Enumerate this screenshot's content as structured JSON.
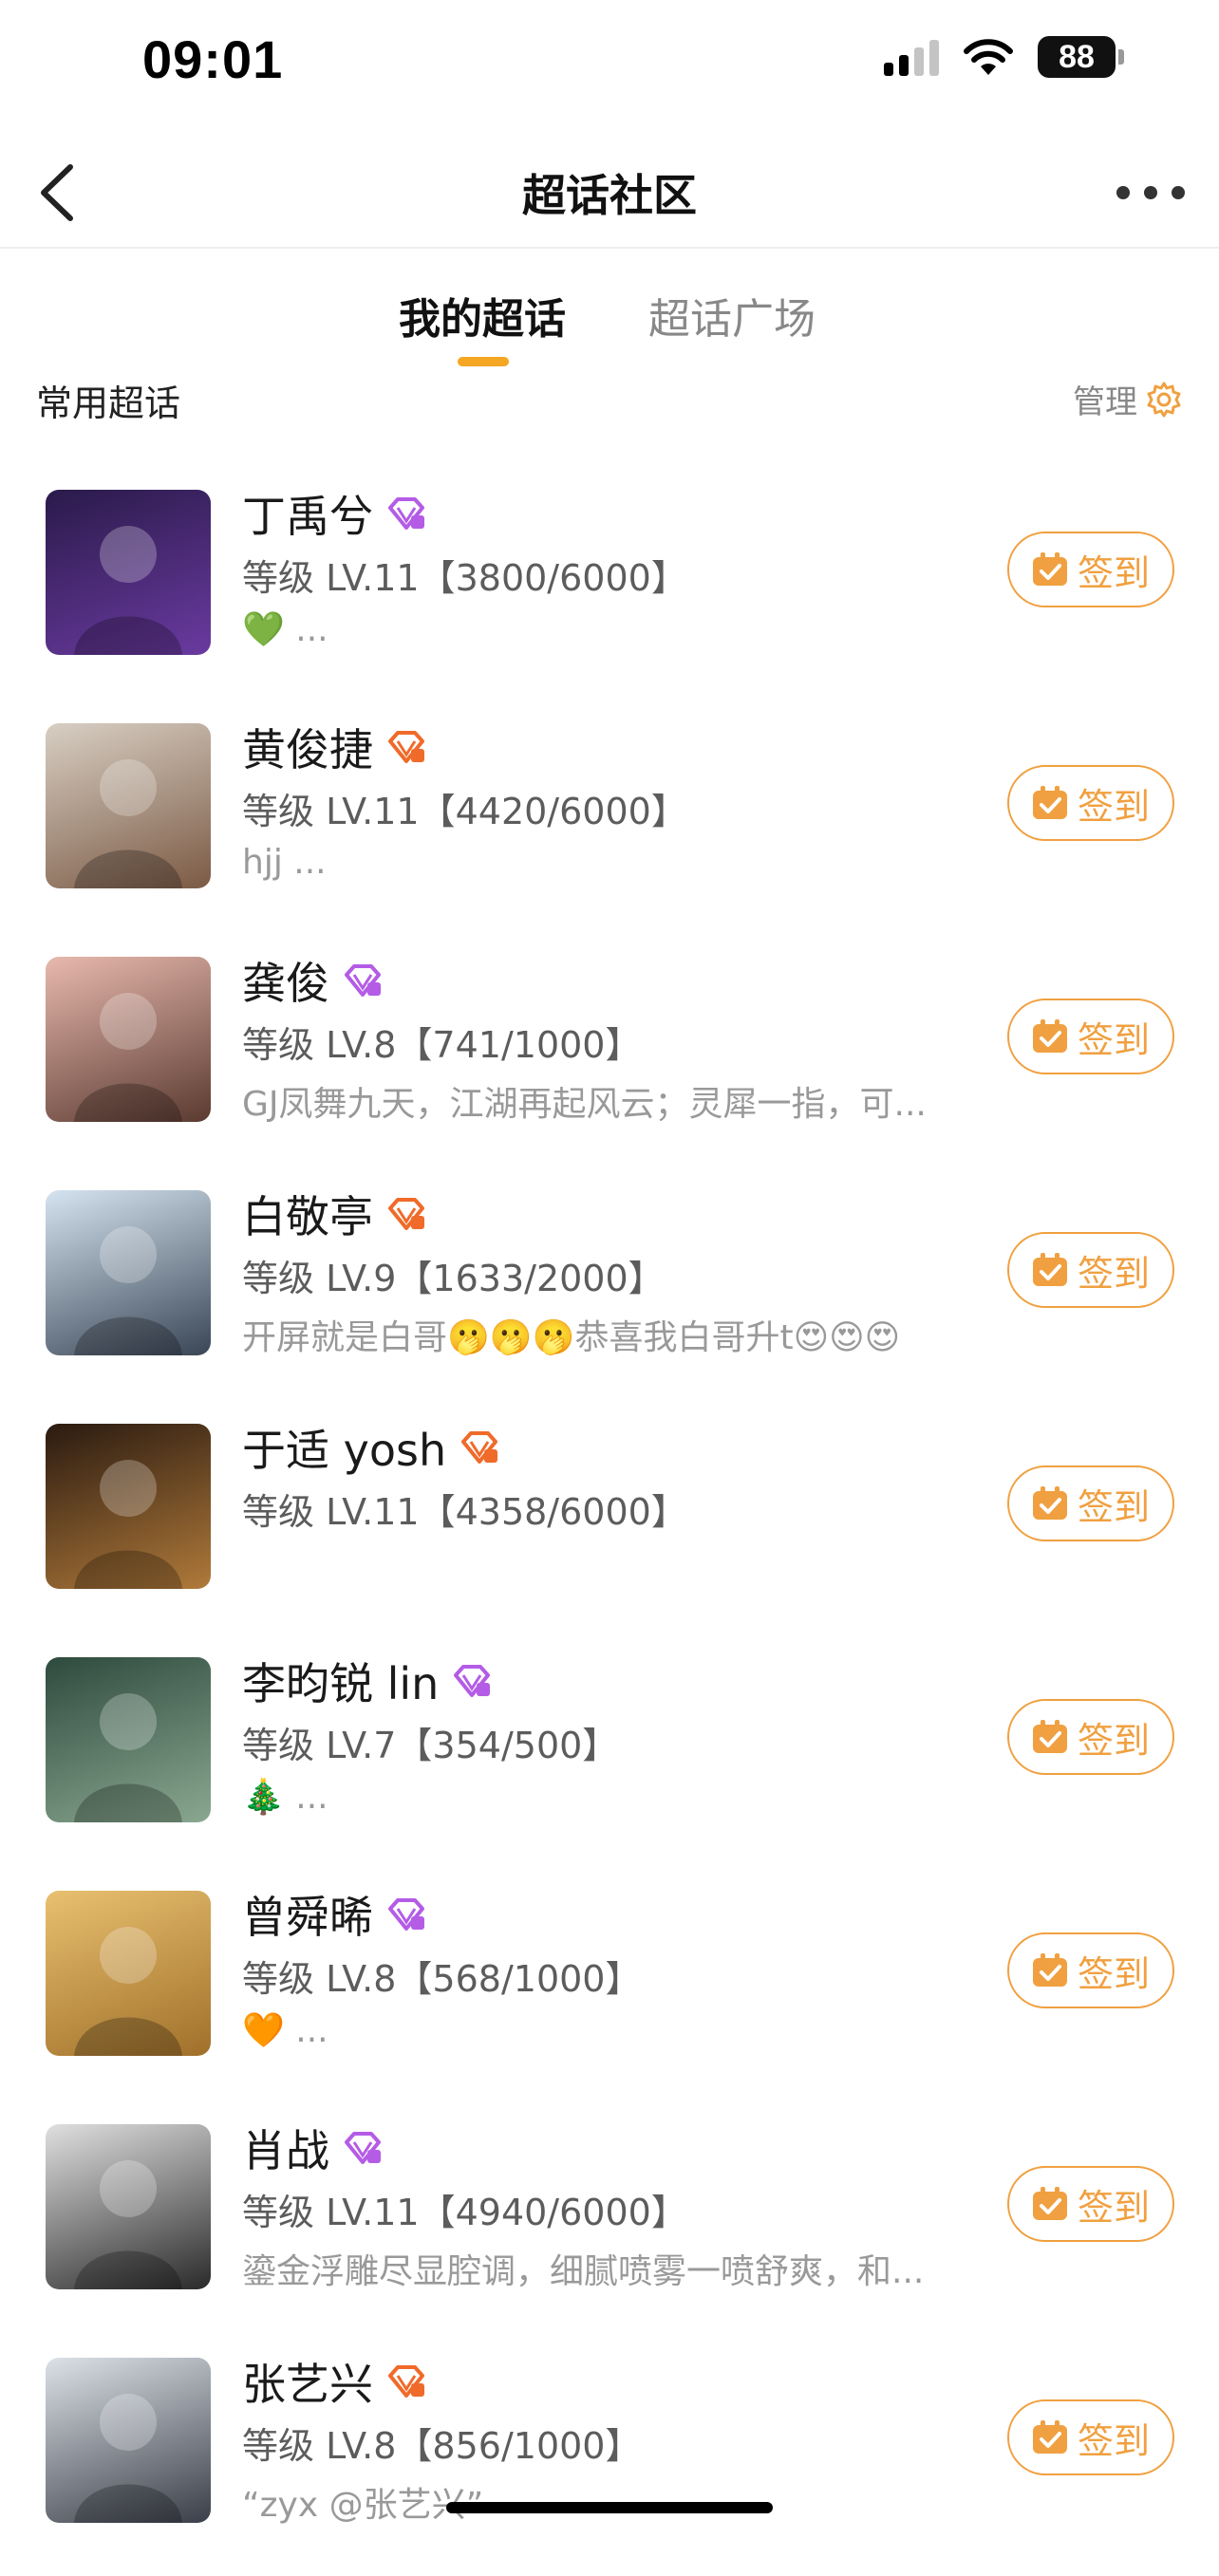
{
  "status": {
    "time": "09:01",
    "battery": "88"
  },
  "nav": {
    "title": "超话社区"
  },
  "tabs": {
    "mine": "我的超话",
    "plaza": "超话广场"
  },
  "section": {
    "title": "常用超话",
    "manage": "管理"
  },
  "checkin_label": "签到",
  "items": [
    {
      "name": "丁禹兮",
      "level": "等级 LV.11【3800/6000】",
      "desc": "💚 ...",
      "badge_color": "#b45ce6",
      "avatar_colors": [
        "#2a1a4a",
        "#6a3aa0"
      ]
    },
    {
      "name": "黄俊捷",
      "level": "等级 LV.11【4420/6000】",
      "desc": "hjj ...",
      "badge_color": "#f06a2a",
      "avatar_colors": [
        "#d8cfc4",
        "#7b5a44"
      ]
    },
    {
      "name": "龚俊",
      "level": "等级 LV.8【741/1000】",
      "desc": "GJ凤舞九天，江湖再起风云；灵犀一指，可...",
      "badge_color": "#b45ce6",
      "avatar_colors": [
        "#e8b9ae",
        "#5a3a30"
      ]
    },
    {
      "name": "白敬亭",
      "level": "等级 LV.9【1633/2000】",
      "desc": "开屏就是白哥🫢🫢🫢恭喜我白哥升t😍😍😍",
      "badge_color": "#f06a2a",
      "avatar_colors": [
        "#d5e4f0",
        "#3a4656"
      ]
    },
    {
      "name": "于适 yosh",
      "level": "等级 LV.11【4358/6000】",
      "desc": "",
      "badge_color": "#f06a2a",
      "avatar_colors": [
        "#2a1a10",
        "#b07a3a"
      ]
    },
    {
      "name": "李昀锐 lin",
      "level": "等级 LV.7【354/500】",
      "desc": "🎄 ...",
      "badge_color": "#b45ce6",
      "avatar_colors": [
        "#2e4a3e",
        "#8aa890"
      ]
    },
    {
      "name": "曾舜晞",
      "level": "等级 LV.8【568/1000】",
      "desc": "🧡 ...",
      "badge_color": "#b45ce6",
      "avatar_colors": [
        "#e8c070",
        "#a0702a"
      ]
    },
    {
      "name": "肖战",
      "level": "等级 LV.11【4940/6000】",
      "desc": "鎏金浮雕尽显腔调，细腻喷雾一喷舒爽，和...",
      "badge_color": "#b45ce6",
      "avatar_colors": [
        "#e0e0e0",
        "#2a2a2a"
      ]
    },
    {
      "name": "张艺兴",
      "level": "等级 LV.8【856/1000】",
      "desc": "“zyx @张艺兴” ~",
      "badge_color": "#f06a2a",
      "avatar_colors": [
        "#dce2e8",
        "#3a3e48"
      ]
    }
  ]
}
